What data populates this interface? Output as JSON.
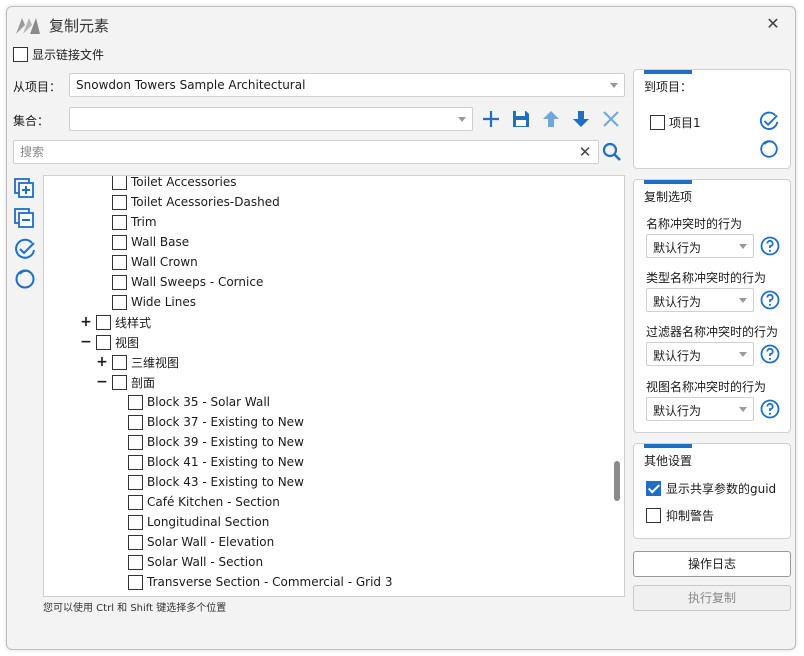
{
  "window": {
    "title": "复制元素"
  },
  "show_linked_files": {
    "label": "显示链接文件",
    "checked": false
  },
  "from_project": {
    "label": "从项目：",
    "value": "Snowdon Towers Sample Architectural"
  },
  "set": {
    "label": "集合：",
    "value": ""
  },
  "search": {
    "placeholder": "搜索"
  },
  "toolbar": {
    "icons": [
      "add-icon",
      "save-icon",
      "arrow-up-icon",
      "arrow-down-icon",
      "delete-icon"
    ],
    "accent_color": "#1f6fc5"
  },
  "tree": {
    "rows": [
      {
        "label": "Toilet Accessories",
        "level": 2,
        "toggle": "",
        "checked": false
      },
      {
        "label": "Toilet Acessories-Dashed",
        "level": 2,
        "toggle": "",
        "checked": false
      },
      {
        "label": "Trim",
        "level": 2,
        "toggle": "",
        "checked": false
      },
      {
        "label": "Wall Base",
        "level": 2,
        "toggle": "",
        "checked": false
      },
      {
        "label": "Wall Crown",
        "level": 2,
        "toggle": "",
        "checked": false
      },
      {
        "label": "Wall Sweeps - Cornice",
        "level": 2,
        "toggle": "",
        "checked": false
      },
      {
        "label": "Wide Lines",
        "level": 2,
        "toggle": "",
        "checked": false
      },
      {
        "label": "线样式",
        "level": 1,
        "toggle": "+",
        "checked": false
      },
      {
        "label": "视图",
        "level": 1,
        "toggle": "−",
        "checked": false
      },
      {
        "label": "三维视图",
        "level": 2,
        "toggle": "+",
        "checked": false
      },
      {
        "label": "剖面",
        "level": 2,
        "toggle": "−",
        "checked": false
      },
      {
        "label": "Block 35 - Solar Wall",
        "level": 3,
        "toggle": "",
        "checked": false
      },
      {
        "label": "Block 37 - Existing to New",
        "level": 3,
        "toggle": "",
        "checked": false
      },
      {
        "label": "Block 39 - Existing to New",
        "level": 3,
        "toggle": "",
        "checked": false
      },
      {
        "label": "Block 41 - Existing to New",
        "level": 3,
        "toggle": "",
        "checked": false
      },
      {
        "label": "Block 43 - Existing to New",
        "level": 3,
        "toggle": "",
        "checked": false
      },
      {
        "label": "Café Kitchen - Section",
        "level": 3,
        "toggle": "",
        "checked": false
      },
      {
        "label": "Longitudinal Section",
        "level": 3,
        "toggle": "",
        "checked": false
      },
      {
        "label": "Solar Wall - Elevation",
        "level": 3,
        "toggle": "",
        "checked": false
      },
      {
        "label": "Solar Wall - Section",
        "level": 3,
        "toggle": "",
        "checked": false
      },
      {
        "label": "Transverse Section - Commercial - Grid 3",
        "level": 3,
        "toggle": "",
        "checked": false
      }
    ]
  },
  "hint": "您可以使用 Ctrl 和 Shift 键选择多个位置",
  "to_project": {
    "title": "到项目：",
    "items": [
      {
        "label": "项目1",
        "checked": false
      }
    ]
  },
  "copy_options": {
    "title": "复制选项",
    "groups": [
      {
        "label": "名称冲突时的行为",
        "value": "默认行为"
      },
      {
        "label": "类型名称冲突时的行为",
        "value": "默认行为"
      },
      {
        "label": "过滤器名称冲突时的行为",
        "value": "默认行为"
      },
      {
        "label": "视图名称冲突时的行为",
        "value": "默认行为"
      }
    ]
  },
  "other_settings": {
    "title": "其他设置",
    "show_shared_param_guid": {
      "label": "显示共享参数的guid",
      "checked": true
    },
    "suppress_warnings": {
      "label": "抑制警告",
      "checked": false
    }
  },
  "buttons": {
    "log": "操作日志",
    "execute": "执行复制"
  }
}
